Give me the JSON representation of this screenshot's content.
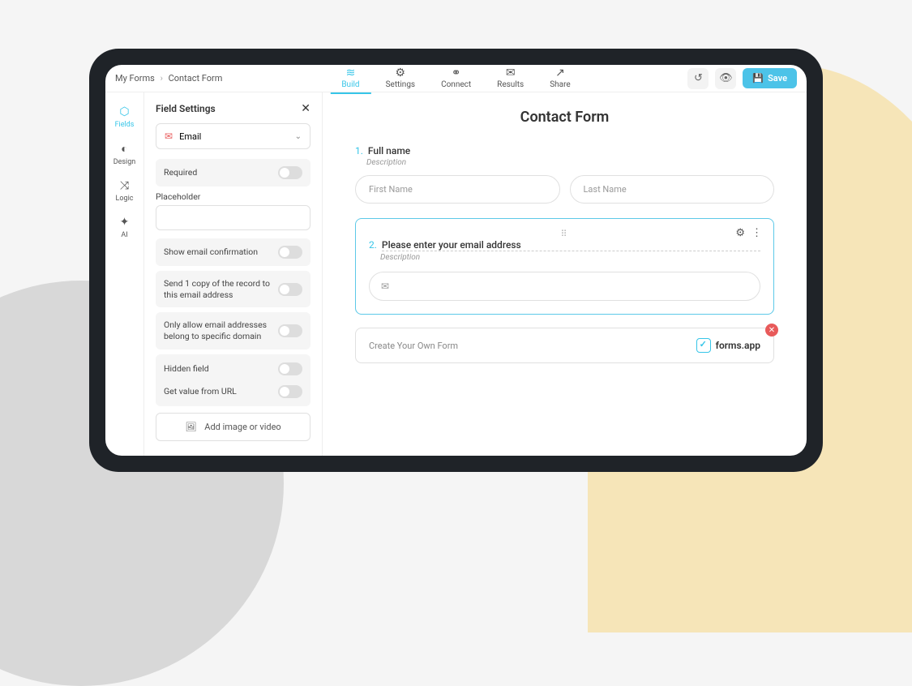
{
  "breadcrumb": {
    "root": "My Forms",
    "current": "Contact Form"
  },
  "tabs": {
    "build": "Build",
    "settings": "Settings",
    "connect": "Connect",
    "results": "Results",
    "share": "Share"
  },
  "actions": {
    "save": "Save"
  },
  "sidebar": {
    "fields": "Fields",
    "design": "Design",
    "logic": "Logic",
    "ai": "AI"
  },
  "panel": {
    "title": "Field Settings",
    "fieldType": "Email",
    "required": "Required",
    "placeholderLabel": "Placeholder",
    "placeholderValue": "",
    "showConfirmation": "Show email confirmation",
    "sendCopy": "Send 1 copy of the record to this email address",
    "domainRestrict": "Only allow email addresses belong to specific domain",
    "hiddenField": "Hidden field",
    "getFromUrl": "Get value from URL",
    "addMedia": "Add image or video"
  },
  "form": {
    "title": "Contact Form",
    "q1": {
      "num": "1.",
      "text": "Full name",
      "desc": "Description",
      "ph1": "First Name",
      "ph2": "Last Name"
    },
    "q2": {
      "num": "2.",
      "text": "Please enter your email address",
      "desc": "Description"
    },
    "cta": "Create Your Own Form",
    "brand": "forms.app"
  }
}
